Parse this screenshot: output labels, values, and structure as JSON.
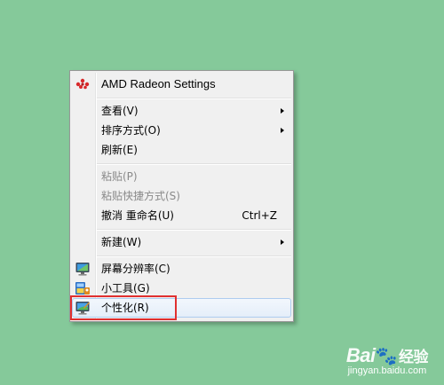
{
  "desktop": {
    "background": "#85c99a"
  },
  "menu": {
    "items": [
      {
        "label": "AMD Radeon Settings",
        "icon": "amd-radeon-icon"
      },
      {
        "label": "查看(V)",
        "submenu": true
      },
      {
        "label": "排序方式(O)",
        "submenu": true
      },
      {
        "label": "刷新(E)"
      },
      {
        "label": "粘贴(P)",
        "disabled": true
      },
      {
        "label": "粘贴快捷方式(S)",
        "disabled": true
      },
      {
        "label": "撤消 重命名(U)",
        "shortcut": "Ctrl+Z"
      },
      {
        "label": "新建(W)",
        "submenu": true
      },
      {
        "label": "屏幕分辨率(C)",
        "icon": "monitor-icon"
      },
      {
        "label": "小工具(G)",
        "icon": "gadgets-icon"
      },
      {
        "label": "个性化(R)",
        "icon": "personalize-icon",
        "highlighted": true
      }
    ]
  },
  "annotation": {
    "color": "#e03030"
  },
  "watermark": {
    "brand": "Bai",
    "brand_suffix": "经验",
    "url": "jingyan.baidu.com"
  }
}
